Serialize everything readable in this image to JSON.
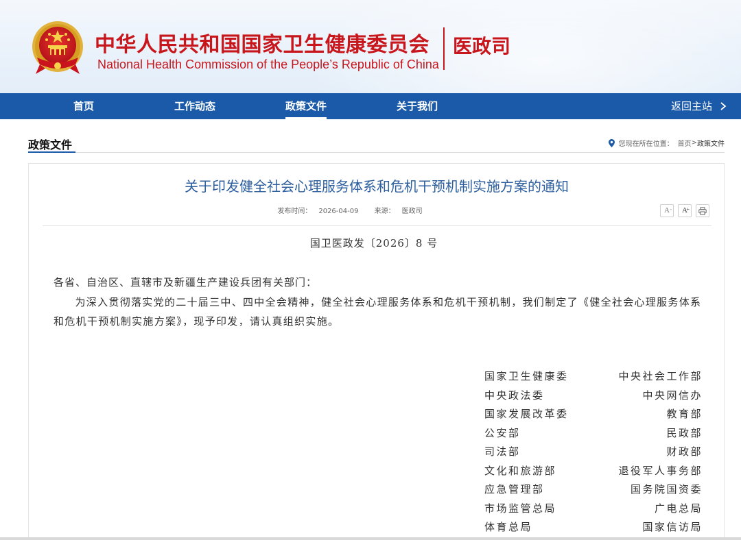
{
  "header": {
    "title_cn": "中华人民共和国国家卫生健康委员会",
    "title_en": "National Health Commission of the People’s  Republic of China",
    "dept": "医政司",
    "emblem_icon": "national-emblem-icon",
    "accent_color": "#c8161d"
  },
  "nav": {
    "items": [
      {
        "label": "首页"
      },
      {
        "label": "工作动态"
      },
      {
        "label": "政策文件"
      },
      {
        "label": "关于我们"
      }
    ],
    "active": "政策文件",
    "back_label": "返回主站",
    "back_icon": "chevron-right-icon",
    "bar_color": "#1a5aa8"
  },
  "section": {
    "title": "政策文件",
    "breadcrumb_prefix": "您现在所在位置：",
    "breadcrumb_home": "首页",
    "breadcrumb_sep": ">",
    "breadcrumb_current": "政策文件",
    "location_icon": "map-pin-icon"
  },
  "article": {
    "title": "关于印发健全社会心理服务体系和危机干预机制实施方案的通知",
    "date_label": "发布时间：",
    "date": "2026-04-09",
    "source_label": "来源：",
    "source": "医政司",
    "tools": [
      {
        "name": "font-decrease-icon",
        "glyph": "A",
        "sup": "-"
      },
      {
        "name": "font-increase-icon",
        "glyph": "A",
        "sup": "+"
      },
      {
        "name": "print-icon"
      }
    ],
    "doc_no": "国卫医政发〔2026〕8 号",
    "salutation": "各省、自治区、直辖市及新疆生产建设兵团有关部门：",
    "body": "为深入贯彻落实党的二十届三中、四中全会精神，健全社会心理服务体系和危机干预机制，我们制定了《健全社会心理服务体系和危机干预机制实施方案》，现予印发，请认真组织实施。",
    "signatories": [
      [
        "国家卫生健康委",
        "中央社会工作部"
      ],
      [
        "中央政法委",
        "中央网信办"
      ],
      [
        "国家发展改革委",
        "教育部"
      ],
      [
        "公安部",
        "民政部"
      ],
      [
        "司法部",
        "财政部"
      ],
      [
        "文化和旅游部",
        "退役军人事务部"
      ],
      [
        "应急管理部",
        "国务院国资委"
      ],
      [
        "市场监管总局",
        "广电总局"
      ],
      [
        "体育总局",
        "国家信访局"
      ]
    ]
  }
}
